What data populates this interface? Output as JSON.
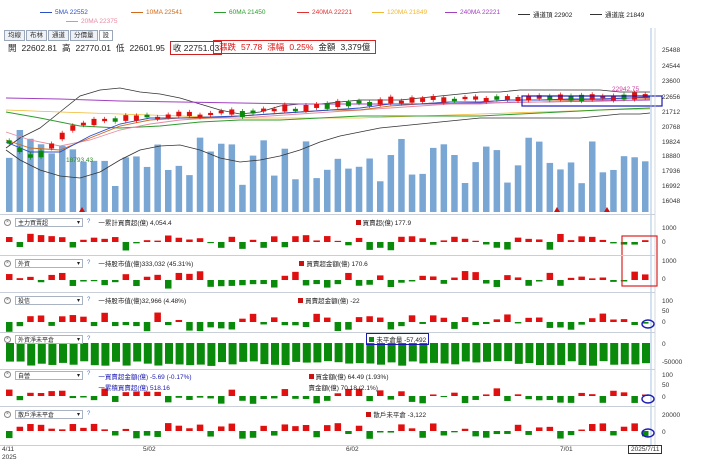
{
  "legend_row1": [
    {
      "label": "5MA 22552",
      "color": "#2a4fc8"
    },
    {
      "label": "10MA 22541",
      "color": "#d06a1a"
    },
    {
      "label": "60MA 21450",
      "color": "#2e9c2e"
    },
    {
      "label": "240MA 22221",
      "color": "#e03030"
    },
    {
      "label": "120MA 21849",
      "color": "#f0b830"
    },
    {
      "label": "240MA 22221",
      "color": "#a040c0"
    },
    {
      "label": "通道頂 22902",
      "color": "#333333"
    },
    {
      "label": "通道底 21849",
      "color": "#333333"
    }
  ],
  "legend_row2": [
    {
      "label": "20MA 22375",
      "color": "#e88aa0"
    }
  ],
  "tabs": [
    "均線",
    "布林",
    "通道",
    "分價量",
    "設"
  ],
  "info": {
    "open_label": "開",
    "open": "22602.81",
    "high_label": "高",
    "high": "22770.01",
    "low_label": "低",
    "low": "22601.95",
    "close_label": "收",
    "close": "22751.03"
  },
  "price_change": {
    "change_label": "漲跌",
    "change": "57.78",
    "pct_label": "漲幅",
    "pct": "0.25%",
    "amount_label": "金額",
    "amount": "3,379億"
  },
  "price_axis": [
    "25488",
    "24544",
    "23600",
    "22656",
    "21712",
    "20768",
    "19824",
    "18880",
    "17936",
    "16992",
    "16048"
  ],
  "chart_annotations": {
    "low_label": "18793.43",
    "high_label": "22942.75"
  },
  "panels": [
    {
      "select": "主力買賣超",
      "items": [
        "一累計買賣超(億) 4,054.4",
        "買賣超(億) 177.9"
      ],
      "axis": [
        "1000",
        "0"
      ]
    },
    {
      "select": "外資",
      "items": [
        "一持股市值(億)333,032 (45.31%)",
        "買賣超金額(億) 170.6"
      ],
      "axis": [
        "1000",
        "0"
      ]
    },
    {
      "select": "投信",
      "items": [
        "一持股市值(億)32,966 (4.48%)",
        "買賣超金額(億) -22"
      ],
      "axis": [
        "100",
        "50",
        "0"
      ]
    },
    {
      "select": "外資淨未平倉",
      "items": [
        "未平倉量 -57,492"
      ],
      "axis": [
        "0",
        "-50000"
      ]
    },
    {
      "select": "自營",
      "items": [
        "一買賣超金額(億) -5.69 (-0.17%)",
        "一累積買賣超(億) 518.16",
        "買金額(億) 64.49 (1.93%)",
        "賣金額(億) 70.18 (2.1%)"
      ],
      "axis": [
        "100",
        "50",
        "0"
      ]
    },
    {
      "select": "散戶淨未平倉",
      "items": [
        "散戶未平倉 -3,122"
      ],
      "axis": [
        "20000",
        "0"
      ]
    }
  ],
  "date_axis": [
    "4/11",
    "5/02",
    "6/02",
    "7/01"
  ],
  "date_axis_year": "2025",
  "cursor_date": "2025/7/11",
  "colors": {
    "up": "#e01010",
    "down": "#0a8a0a",
    "volume": "#7aa6d4",
    "highlight": "#1a1ab0",
    "callout": "#dd2222"
  }
}
